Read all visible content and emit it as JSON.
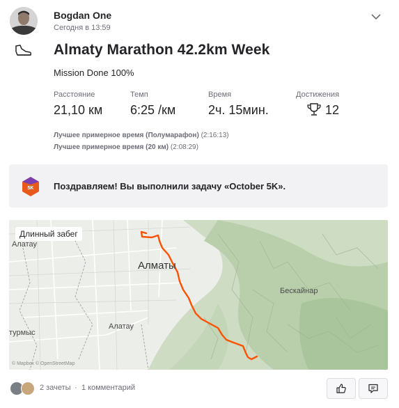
{
  "athlete": {
    "name": "Bogdan One",
    "timestamp": "Сегодня в 13:59"
  },
  "activity": {
    "title": "Almaty Marathon 42.2km Week",
    "description": "Mission Done 100%",
    "sport_icon": "running-shoe-icon"
  },
  "stats": [
    {
      "label": "Расстояние",
      "value": "21,10 км"
    },
    {
      "label": "Темп",
      "value": "6:25 /км"
    },
    {
      "label": "Время",
      "value": "2ч. 15мин."
    },
    {
      "label": "Достижения",
      "value": "12",
      "icon": "trophy-icon"
    }
  ],
  "best_efforts": [
    {
      "label": "Лучшее примерное время (Полумарафон)",
      "value": "(2:16:13)"
    },
    {
      "label": "Лучшее примерное время (20 км)",
      "value": "(2:08:29)"
    }
  ],
  "challenge": {
    "message": "Поздравляем! Вы выполнили задачу «October 5K».",
    "badge_text": "5K",
    "badge_color": "#e85a1c"
  },
  "map": {
    "activity_type_label": "Длинный забег",
    "places": {
      "city": "Алматы",
      "alatau_left": "Алатау",
      "bes_kainar": "Бескайнар",
      "turmys": "турмыс",
      "alatau_bottom": "Алатау"
    },
    "route_color": "#fc5200",
    "attribution": "© Mapbox © OpenStreetMap"
  },
  "social": {
    "kudos": "2 зачеты",
    "separator": "·",
    "comments": "1 комментарий"
  },
  "colors": {
    "brand": "#fc5200",
    "text": "#242428",
    "muted": "#6d6d78"
  }
}
